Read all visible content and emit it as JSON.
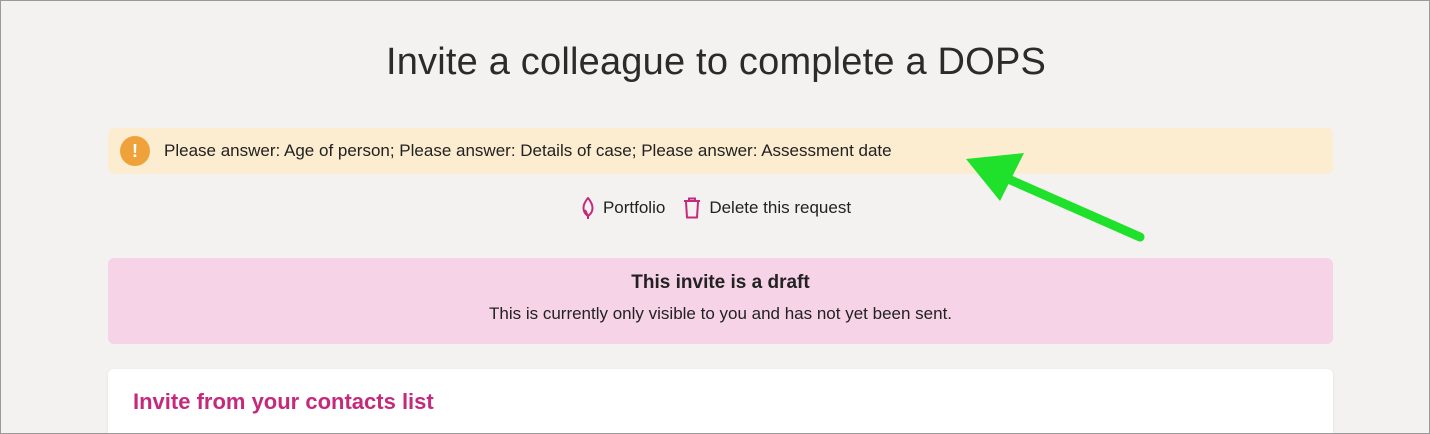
{
  "page": {
    "title": "Invite a colleague to complete a DOPS"
  },
  "warning": {
    "icon": "exclamation-icon",
    "icon_glyph": "!",
    "message": "Please answer: Age of person; Please answer: Details of case; Please answer: Assessment date",
    "color": "#efa23a",
    "background": "#fcecd0"
  },
  "actions": {
    "portfolio_label": "Portfolio",
    "delete_label": "Delete this request",
    "icon_color": "#c42a7c"
  },
  "draft": {
    "title": "This invite is a draft",
    "text": "This is currently only visible to you and has not yet been sent.",
    "background": "#f6d3e6"
  },
  "contacts": {
    "title": "Invite from your contacts list",
    "color": "#c42a7c"
  },
  "annotation": {
    "color": "#1fe02a"
  }
}
